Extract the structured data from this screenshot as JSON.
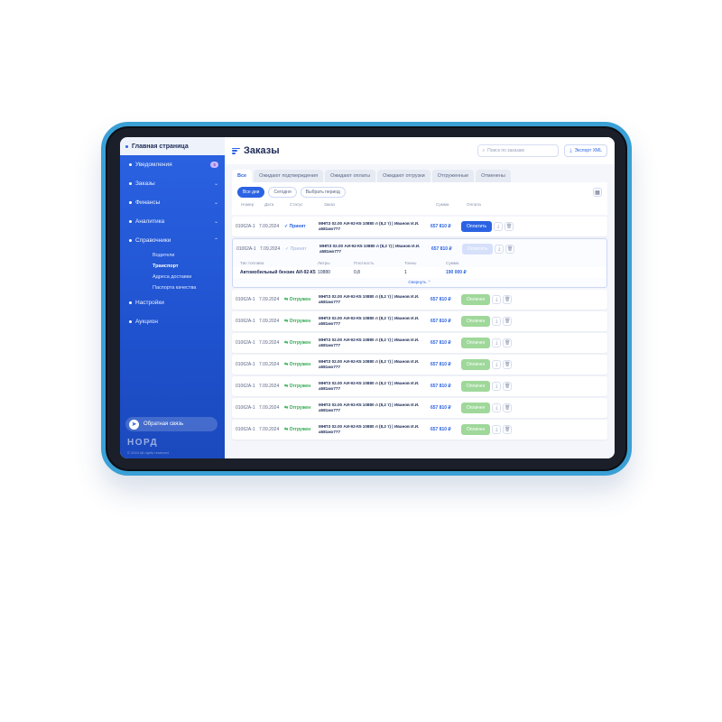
{
  "sidebar": {
    "home": "Главная страница",
    "items": [
      {
        "label": "Уведомления",
        "badge": "5"
      },
      {
        "label": "Заказы"
      },
      {
        "label": "Финансы"
      },
      {
        "label": "Аналитика"
      },
      {
        "label": "Справочники"
      }
    ],
    "subitems": [
      "Водители",
      "Транспорт",
      "Адреса доставки",
      "Паспорта качества"
    ],
    "bottom_items": [
      "Настройки",
      "Аукцион"
    ],
    "feedback": "Обратная связь",
    "brand": "НОРД",
    "copyright": "© 2024 All rights reserved"
  },
  "header": {
    "title": "Заказы",
    "search_placeholder": "Поиск по заказам",
    "export_label": "Экспорт XML"
  },
  "tabs": [
    "Все",
    "Ожидают подтверждения",
    "Ожидают оплаты",
    "Ожидают отгрузки",
    "Отгруженные",
    "Отменены"
  ],
  "filters": [
    "Все дни",
    "Сегодня",
    "Выбрать период"
  ],
  "table": {
    "headers": [
      "Номер",
      "Дата",
      "Статус",
      "Заказ",
      "Сумма",
      "Оплата"
    ]
  },
  "rows": [
    {
      "num": "01062А-1",
      "date": "7.09.2024",
      "status": "✓ Принят",
      "status_kind": "accept",
      "order": "МНПЗ 02.00 АИ-92-К5 10880 л (8,2 т) | Иванов И.И. а581мо777",
      "sum": "657 810 ₽",
      "action": "Оплатить",
      "btn_kind": "blue"
    },
    {
      "num": "01062А-1",
      "date": "7.09.2024",
      "status": "✓ Принят",
      "status_kind": "faded",
      "order": "МНПЗ 02.00 АИ-92-К5 10880 л (8,2 т) | Иванов И.И. а581мо777",
      "sum": "657 810 ₽",
      "action": "Оплатить",
      "btn_kind": "faded"
    },
    {
      "num": "01062А-1",
      "date": "7.09.2024",
      "status": "⇆ Отгружен",
      "status_kind": "ok",
      "order": "МНПЗ 02.00 АИ-92-К5 10880 л (8,2 т) | Иванов И.И. а581мо777",
      "sum": "657 810 ₽",
      "action": "Оплачен",
      "btn_kind": "green"
    },
    {
      "num": "01062А-1",
      "date": "7.09.2024",
      "status": "⇆ Отгружен",
      "status_kind": "ok",
      "order": "МНПЗ 02.00 АИ-92-К5 10880 л (8,2 т) | Иванов И.И. а581мо777",
      "sum": "657 810 ₽",
      "action": "Оплачен",
      "btn_kind": "green"
    },
    {
      "num": "01062А-1",
      "date": "7.09.2024",
      "status": "⇆ Отгружен",
      "status_kind": "ok",
      "order": "МНПЗ 02.00 АИ-92-К5 10880 л (8,2 т) | Иванов И.И. а581мо777",
      "sum": "657 810 ₽",
      "action": "Оплачен",
      "btn_kind": "green"
    },
    {
      "num": "01062А-1",
      "date": "7.09.2024",
      "status": "⇆ Отгружен",
      "status_kind": "ok",
      "order": "МНПЗ 02.00 АИ-92-К5 10880 л (8,2 т) | Иванов И.И. а581мо777",
      "sum": "657 810 ₽",
      "action": "Оплачен",
      "btn_kind": "green"
    },
    {
      "num": "01062А-1",
      "date": "7.09.2024",
      "status": "⇆ Отгружен",
      "status_kind": "ok",
      "order": "МНПЗ 02.00 АИ-92-К5 10880 л (8,2 т) | Иванов И.И. а581мо777",
      "sum": "657 810 ₽",
      "action": "Оплачен",
      "btn_kind": "green"
    },
    {
      "num": "01062А-1",
      "date": "7.09.2024",
      "status": "⇆ Отгружен",
      "status_kind": "ok",
      "order": "МНПЗ 02.00 АИ-92-К5 10880 л (8,2 т) | Иванов И.И. а581мо777",
      "sum": "657 810 ₽",
      "action": "Оплачен",
      "btn_kind": "green"
    },
    {
      "num": "01062А-1",
      "date": "7.09.2024",
      "status": "⇆ Отгружен",
      "status_kind": "ok",
      "order": "МНПЗ 02.00 АИ-92-К5 10880 л (8,2 т) | Иванов И.И. а581мо777",
      "sum": "657 810 ₽",
      "action": "Оплачен",
      "btn_kind": "green"
    }
  ],
  "expanded": {
    "headers": [
      "Тип топлива",
      "Литры",
      "Плотность",
      "Тонны",
      "Сумма"
    ],
    "product": "Автомобильный бензин АИ-92-К5",
    "tare": "10880",
    "volume": "0,8",
    "price": "1",
    "sum": "190 000 ₽",
    "collapse_label": "Свернуть ⌃"
  },
  "colors": {
    "accent": "#2b63e3",
    "sidebar": "#1f52cf",
    "success": "#2fa84f",
    "tablet_frame": "#3aa0d6"
  }
}
